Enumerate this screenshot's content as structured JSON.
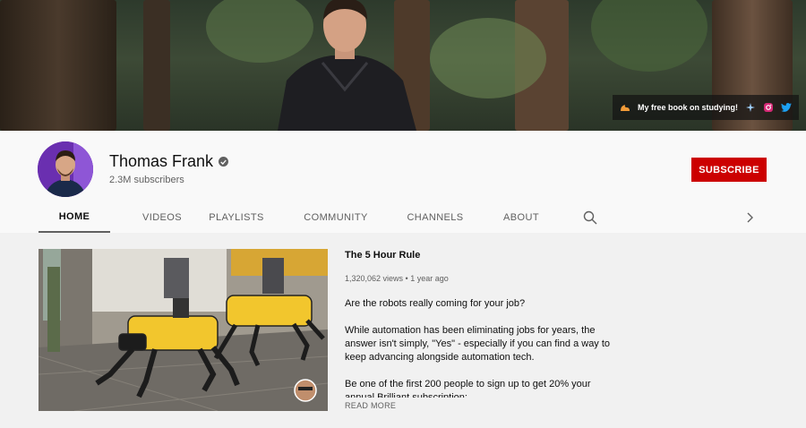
{
  "banner": {
    "link_text": "My free book on studying!",
    "link_icons": [
      "flame-logo-icon",
      "notion-star-icon",
      "instagram-icon",
      "twitter-icon"
    ]
  },
  "channel": {
    "name": "Thomas Frank",
    "subscribers": "2.3M subscribers",
    "subscribe_label": "SUBSCRIBE"
  },
  "tabs": [
    {
      "label": "HOME",
      "active": true
    },
    {
      "label": "VIDEOS",
      "active": false
    },
    {
      "label": "PLAYLISTS",
      "active": false
    },
    {
      "label": "COMMUNITY",
      "active": false
    },
    {
      "label": "CHANNELS",
      "active": false
    },
    {
      "label": "ABOUT",
      "active": false
    }
  ],
  "featured_video": {
    "title": "The 5 Hour Rule",
    "meta": "1,320,062 views • 1 year ago",
    "description": [
      "Are the robots really coming for your job?",
      "While automation has been eliminating jobs for years, the answer isn't simply, \"Yes\" - especially if you can find a way to keep advancing alongside automation tech.",
      "Be one of the first 200 people to sign up to get 20% your annual Brilliant subscription:"
    ],
    "read_more": "READ MORE"
  },
  "colors": {
    "subscribe": "#cc0000",
    "instagram": "#d62976",
    "twitter": "#1da1f2",
    "avatar_bg": "#6a2fb0"
  }
}
